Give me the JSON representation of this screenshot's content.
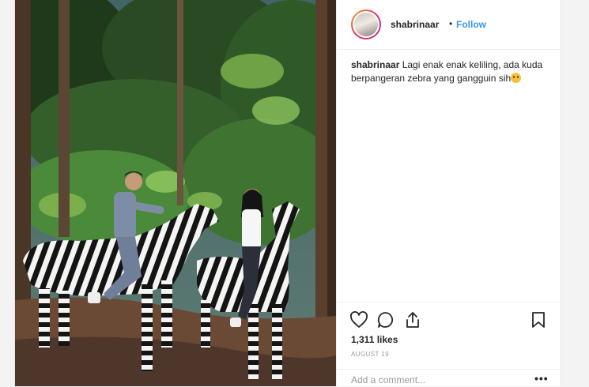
{
  "post": {
    "username": "shabrinaar",
    "separator": "•",
    "follow_label": "Follow",
    "caption_user": "shabrinaar",
    "caption_text": "Lagi enak enak keliling, ada kuda berpangeran zebra yang gangguin sih",
    "caption_emoji": "face-emoji",
    "likes": "1,311 likes",
    "date": "AUGUST 19",
    "comment_placeholder": "Add a comment...",
    "more_label": "•••"
  },
  "icons": [
    "heart-icon",
    "comment-icon",
    "share-icon",
    "bookmark-icon"
  ],
  "colors": {
    "link": "#3897f0",
    "text": "#262626",
    "muted": "#999999",
    "border": "#efefef"
  }
}
